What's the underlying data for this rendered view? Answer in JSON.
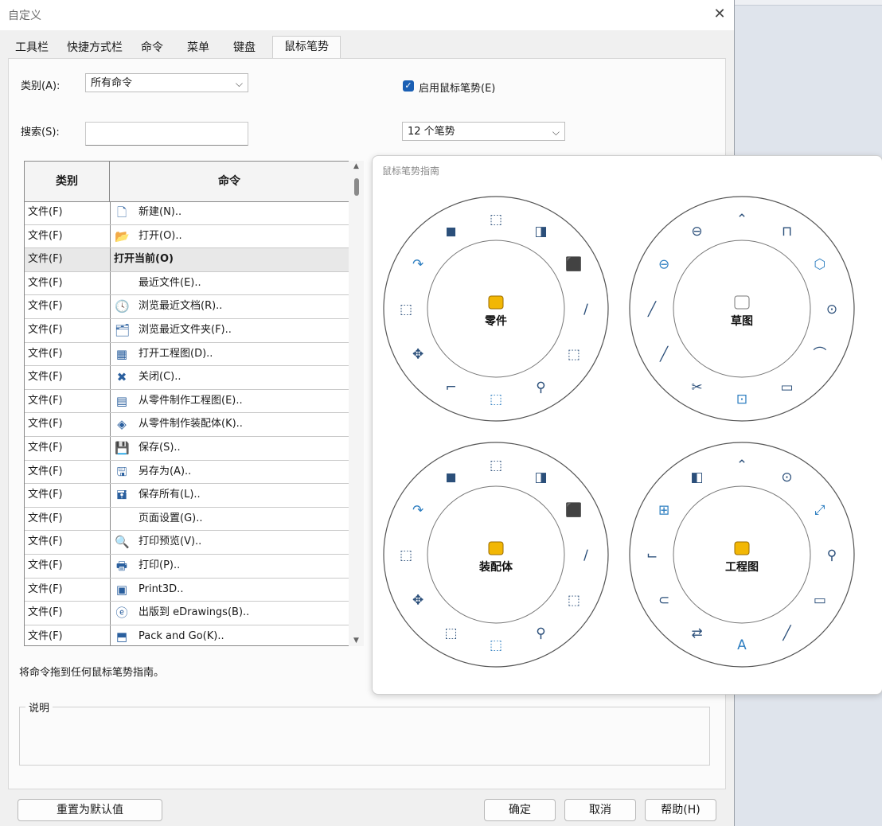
{
  "dialog": {
    "title": "自定义"
  },
  "tabs": [
    "工具栏",
    "快捷方式栏",
    "命令",
    "菜单",
    "键盘",
    "鼠标笔势"
  ],
  "category_label": "类别(A):",
  "category_value": "所有命令",
  "search_label": "搜索(S):",
  "enable_label": "启用鼠标笔势(E)",
  "gesture_count_value": "12 个笔势",
  "table": {
    "headers": [
      "类别",
      "命令"
    ],
    "rows": [
      {
        "cat": "文件(F)",
        "cmd": "新建(N)..",
        "icon": "new-document-icon"
      },
      {
        "cat": "文件(F)",
        "cmd": "打开(O)..",
        "icon": "open-folder-icon"
      },
      {
        "cat": "文件(F)",
        "cmd": "打开当前(O)",
        "icon": "",
        "selected": true
      },
      {
        "cat": "文件(F)",
        "cmd": "最近文件(E)..",
        "icon": ""
      },
      {
        "cat": "文件(F)",
        "cmd": "浏览最近文档(R)..",
        "icon": "recent-documents-icon"
      },
      {
        "cat": "文件(F)",
        "cmd": "浏览最近文件夹(F)..",
        "icon": "recent-folders-icon"
      },
      {
        "cat": "文件(F)",
        "cmd": "打开工程图(D)..",
        "icon": "open-drawing-icon"
      },
      {
        "cat": "文件(F)",
        "cmd": "关闭(C)..",
        "icon": "close-document-icon"
      },
      {
        "cat": "文件(F)",
        "cmd": "从零件制作工程图(E)..",
        "icon": "make-drawing-icon"
      },
      {
        "cat": "文件(F)",
        "cmd": "从零件制作装配体(K)..",
        "icon": "make-assembly-icon"
      },
      {
        "cat": "文件(F)",
        "cmd": "保存(S)..",
        "icon": "save-icon"
      },
      {
        "cat": "文件(F)",
        "cmd": "另存为(A)..",
        "icon": "save-as-icon"
      },
      {
        "cat": "文件(F)",
        "cmd": "保存所有(L)..",
        "icon": "save-all-icon"
      },
      {
        "cat": "文件(F)",
        "cmd": "页面设置(G)..",
        "icon": ""
      },
      {
        "cat": "文件(F)",
        "cmd": "打印预览(V)..",
        "icon": "print-preview-icon"
      },
      {
        "cat": "文件(F)",
        "cmd": "打印(P)..",
        "icon": "print-icon"
      },
      {
        "cat": "文件(F)",
        "cmd": "Print3D..",
        "icon": "print3d-icon"
      },
      {
        "cat": "文件(F)",
        "cmd": "出版到 eDrawings(B)..",
        "icon": "edrawings-icon"
      },
      {
        "cat": "文件(F)",
        "cmd": "Pack and Go(K)..",
        "icon": "pack-and-go-icon"
      }
    ]
  },
  "drag_hint": "将命令拖到任何鼠标笔势指南。",
  "description_label": "说明",
  "buttons": {
    "reset": "重置为默认值",
    "ok": "确定",
    "cancel": "取消",
    "help": "帮助(H)"
  },
  "guide": {
    "title": "鼠标笔势指南",
    "rings": [
      {
        "label": "零件",
        "center_icon": "part-icon"
      },
      {
        "label": "草图",
        "center_icon": "sketch-icon"
      },
      {
        "label": "装配体",
        "center_icon": "assembly-icon"
      },
      {
        "label": "工程图",
        "center_icon": "drawing-icon"
      }
    ]
  },
  "colors": {
    "accent": "#1a5fb4",
    "icon_blue": "#2f7fc1",
    "icon_yellow": "#f2b705"
  }
}
